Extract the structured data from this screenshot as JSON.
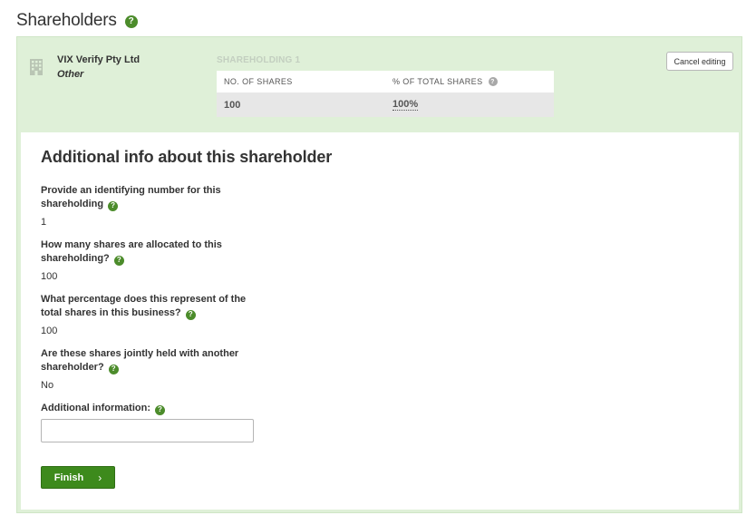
{
  "page": {
    "title": "Shareholders",
    "help_icon": "?"
  },
  "shareholder": {
    "name": "VIX Verify Pty Ltd",
    "type": "Other",
    "icon": "building-icon"
  },
  "holding": {
    "title": "SHAREHOLDING 1",
    "columns": [
      "NO. OF SHARES",
      "% OF TOTAL SHARES"
    ],
    "shares": "100",
    "percent": "100%"
  },
  "actions": {
    "cancel_label": "Cancel editing",
    "finish_label": "Finish",
    "finish_chevron": "›"
  },
  "info": {
    "title": "Additional info about this shareholder",
    "fields": [
      {
        "label": "Provide an identifying number for this shareholding",
        "value": "1"
      },
      {
        "label": "How many shares are allocated to this shareholding?",
        "value": "100"
      },
      {
        "label": "What percentage does this represent of the total shares in this business?",
        "value": "100"
      },
      {
        "label": "Are these shares jointly held with another shareholder?",
        "value": "No"
      },
      {
        "label": "Additional information:",
        "value": ""
      }
    ]
  },
  "colors": {
    "accent": "#3d8a1c",
    "panel_bg": "#dff0d8",
    "help_icon": "#4c8c2b"
  }
}
